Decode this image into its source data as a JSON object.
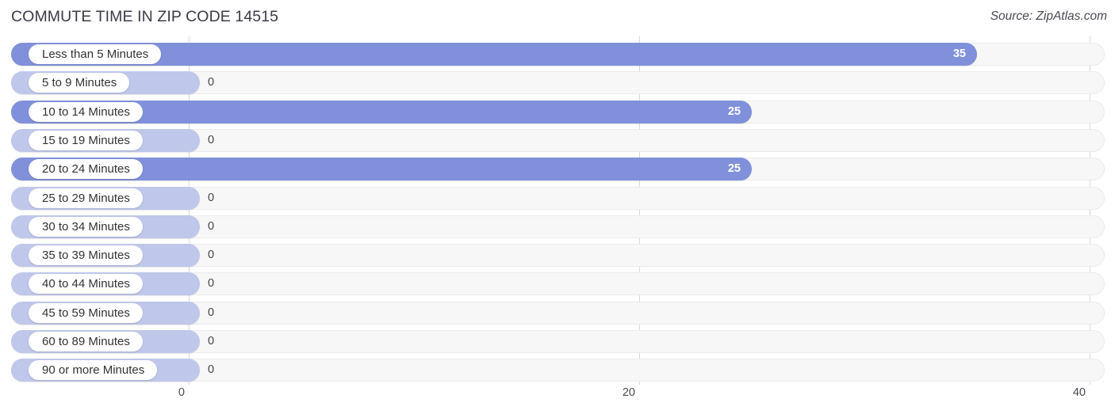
{
  "header": {
    "title": "COMMUTE TIME IN ZIP CODE 14515",
    "source": "Source: ZipAtlas.com"
  },
  "colors": {
    "bar_filled": "#8090da",
    "bar_empty": "#bfc7ea",
    "track": "#f7f7f7",
    "gridline": "#d9d9d9",
    "value_inside_text": "#ffffff",
    "value_outside_text": "#444444"
  },
  "chart_data": {
    "type": "bar",
    "orientation": "horizontal",
    "title": "COMMUTE TIME IN ZIP CODE 14515",
    "xlabel": "",
    "ylabel": "",
    "xlim": [
      0,
      40
    ],
    "grid": true,
    "legend": false,
    "xticks": [
      0,
      20,
      40
    ],
    "xtick_labels": [
      "0",
      "20",
      "40"
    ],
    "categories": [
      "Less than 5 Minutes",
      "5 to 9 Minutes",
      "10 to 14 Minutes",
      "15 to 19 Minutes",
      "20 to 24 Minutes",
      "25 to 29 Minutes",
      "30 to 34 Minutes",
      "35 to 39 Minutes",
      "40 to 44 Minutes",
      "45 to 59 Minutes",
      "60 to 89 Minutes",
      "90 or more Minutes"
    ],
    "values": [
      35,
      0,
      25,
      0,
      25,
      0,
      0,
      0,
      0,
      0,
      0,
      0
    ],
    "value_labels": [
      "35",
      "0",
      "25",
      "0",
      "25",
      "0",
      "0",
      "0",
      "0",
      "0",
      "0",
      "0"
    ]
  }
}
